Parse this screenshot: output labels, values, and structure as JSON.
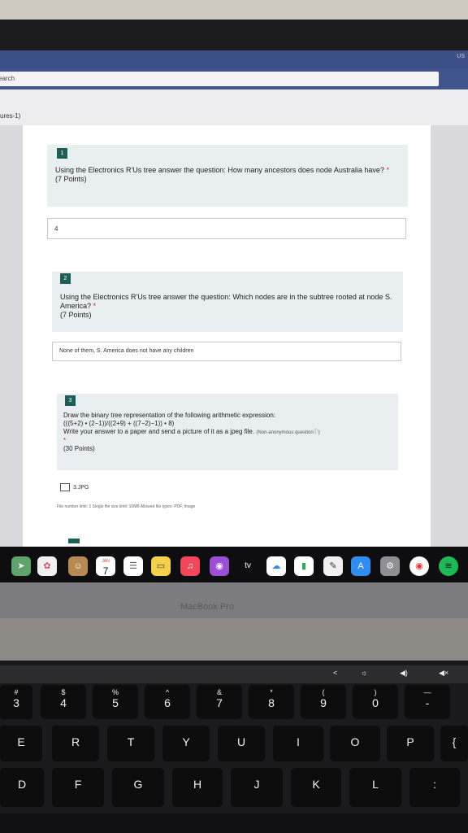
{
  "browser": {
    "lang_badge": "US",
    "search_placeholder": "earch",
    "breadcrumb": "ures-1)"
  },
  "questions": [
    {
      "number": "1",
      "text": "Using the Electronics R'Us tree answer the question: How many ancestors does node Australia have?",
      "required_mark": "*",
      "points": "(7 Points)",
      "answer": "4"
    },
    {
      "number": "2",
      "text": "Using the Electronics R'Us tree answer the question: Which nodes are in the subtree rooted at node S. America?",
      "required_mark": "*",
      "points": "(7 Points)",
      "answer": "None of them, S. America does not have any children"
    },
    {
      "number": "3",
      "line1": "Draw the binary tree representation of the following arithmetic expression:",
      "line2": "(((5+2) • (2−1))/((2+9) + ((7−2)−1)) • 8)",
      "line3": "Write your answer to a paper and send a picture of it as a jpeg file.",
      "note": "(Non-anonymous question",
      "note_icon_close": ")",
      "required_mark": "*",
      "points": "(30 Points)",
      "file_name": "3.JPG",
      "file_limits": "File number limit: 1   Single file size limit: 10MB   Allowed file types: PDF, Image"
    }
  ],
  "touchbar": {
    "calendar_month": "JAN",
    "calendar_day": "7",
    "appletv": "tv"
  },
  "laptop_label": "MacBook Pro",
  "keyboard": {
    "fn_row": [
      "<",
      "☼",
      "◀)",
      "◀×"
    ],
    "number_row": [
      {
        "top": "#",
        "bot": "3"
      },
      {
        "top": "$",
        "bot": "4"
      },
      {
        "top": "%",
        "bot": "5"
      },
      {
        "top": "^",
        "bot": "6"
      },
      {
        "top": "&",
        "bot": "7"
      },
      {
        "top": "*",
        "bot": "8"
      },
      {
        "top": "(",
        "bot": "9"
      },
      {
        "top": ")",
        "bot": "0"
      },
      {
        "top": "—",
        "bot": "-"
      }
    ],
    "row_qwerty": [
      "E",
      "R",
      "T",
      "Y",
      "U",
      "I",
      "O",
      "P",
      "{"
    ],
    "row_home": [
      "D",
      "F",
      "G",
      "H",
      "J",
      "K",
      "L",
      ":"
    ]
  }
}
